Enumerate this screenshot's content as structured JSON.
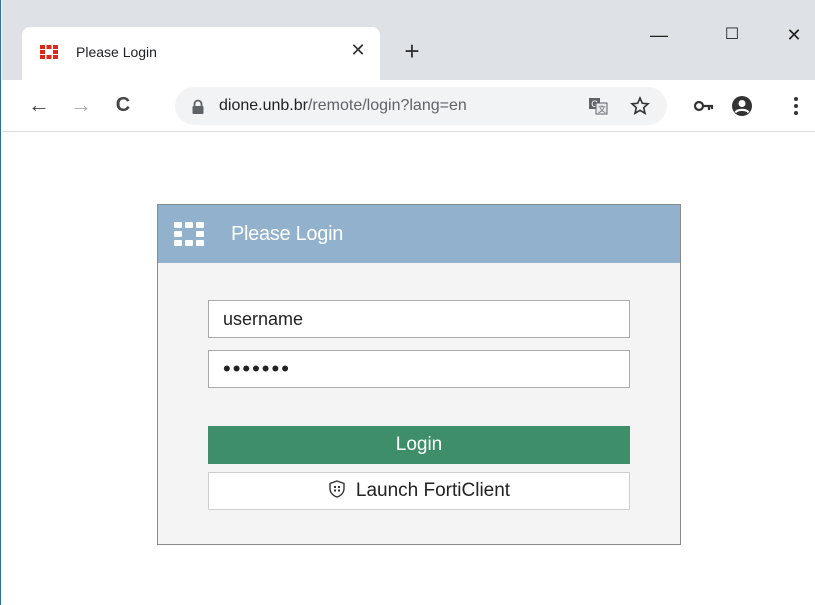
{
  "browser": {
    "tab": {
      "title": "Please Login"
    },
    "url": {
      "host": "dione.unb.br",
      "path": "/remote/login?lang=en"
    },
    "icons": {
      "favicon": "fortinet-logo-icon",
      "close": "close-icon",
      "new_tab": "plus-icon",
      "minimize": "minimize-icon",
      "maximize": "maximize-icon",
      "window_close": "close-icon",
      "back": "back-arrow-icon",
      "forward": "forward-arrow-icon",
      "reload": "reload-icon",
      "lock": "lock-icon",
      "translate": "translate-icon",
      "bookmark": "star-icon",
      "passwords": "key-icon",
      "profile": "account-icon",
      "menu": "kebab-menu-icon"
    },
    "glyphs": {
      "close": "✕",
      "new_tab": "+",
      "minimize": "—",
      "maximize": "☐",
      "window_close": "✕",
      "back": "←",
      "forward": "→",
      "reload": "C"
    }
  },
  "login": {
    "header_title": "Please Login",
    "username_value": "username",
    "password_mask": "•••••••",
    "login_label": "Login",
    "forticlient_label": "Launch FortiClient"
  },
  "colors": {
    "header_bg": "#91b1cc",
    "login_button": "#3e8e6a",
    "fortinet_red": "#da291c"
  }
}
